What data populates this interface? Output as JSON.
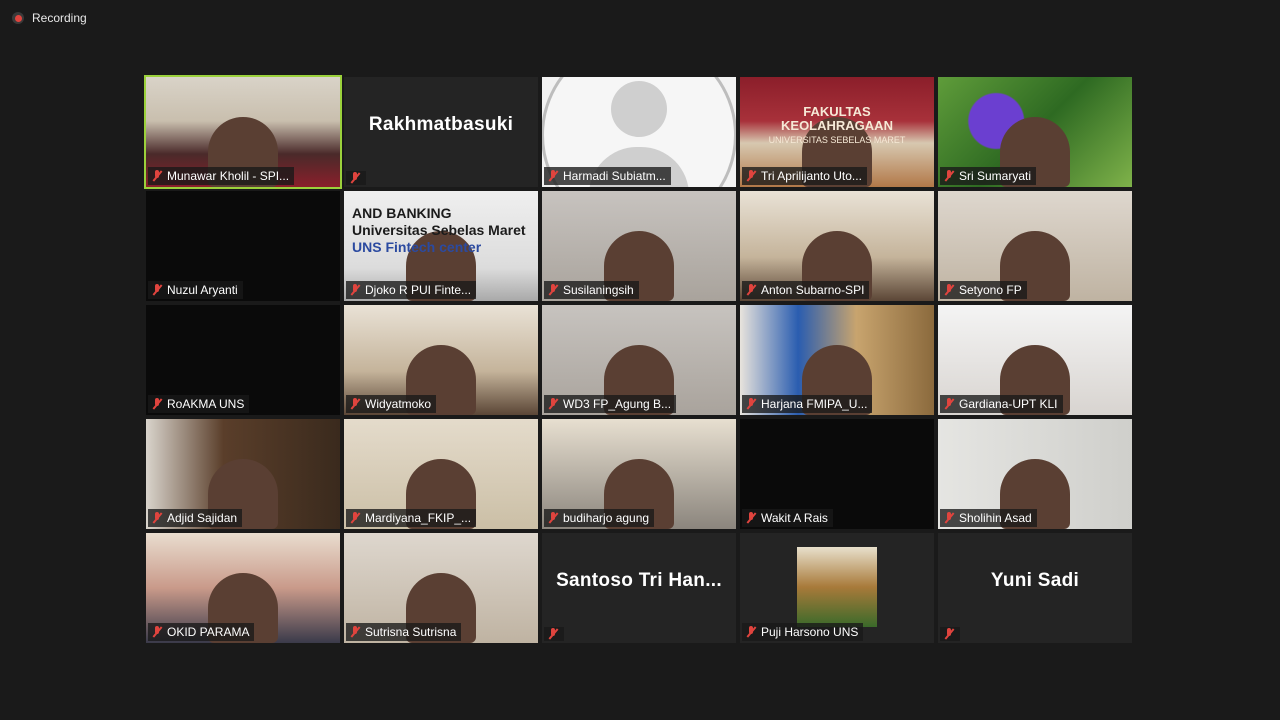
{
  "recording": {
    "label": "Recording"
  },
  "participants": [
    {
      "name": "Munawar Kholil - SPI...",
      "view": "video",
      "bg": "v-office1",
      "active": true
    },
    {
      "name": "",
      "view": "name",
      "display_name": "Rakhmatbasuki"
    },
    {
      "name": "Harmadi Subiatm...",
      "view": "avatar"
    },
    {
      "name": "Tri Aprilijanto Uto...",
      "view": "video",
      "bg": "v-poster",
      "overlay": "poster"
    },
    {
      "name": "Sri Sumaryati",
      "view": "video",
      "bg": "v-flower"
    },
    {
      "name": "Nuzul Aryanti",
      "view": "video",
      "bg": "v-dark"
    },
    {
      "name": "Djoko R PUI Finte...",
      "view": "video",
      "bg": "v-bank",
      "overlay": "bank"
    },
    {
      "name": "Susilaningsih",
      "view": "video",
      "bg": "v-gray"
    },
    {
      "name": "Anton Subarno-SPI",
      "view": "video",
      "bg": "v-room"
    },
    {
      "name": "Setyono FP",
      "view": "video",
      "bg": "v-room2"
    },
    {
      "name": "RoAKMA UNS",
      "view": "video",
      "bg": "v-dark"
    },
    {
      "name": "Widyatmoko",
      "view": "video",
      "bg": "v-room"
    },
    {
      "name": "WD3 FP_Agung B...",
      "view": "video",
      "bg": "v-gray"
    },
    {
      "name": "Harjana FMIPA_U...",
      "view": "video",
      "bg": "v-blue"
    },
    {
      "name": "Gardiana-UPT KLI",
      "view": "video",
      "bg": "v-white"
    },
    {
      "name": "Adjid Sajidan",
      "view": "video",
      "bg": "v-shelf"
    },
    {
      "name": "Mardiyana_FKIP_...",
      "view": "video",
      "bg": "v-wall"
    },
    {
      "name": "budiharjo agung",
      "view": "video",
      "bg": "v-wood"
    },
    {
      "name": "Wakit A Rais",
      "view": "video",
      "bg": "v-dark"
    },
    {
      "name": "Sholihin Asad",
      "view": "video",
      "bg": "v-light"
    },
    {
      "name": "OKID PARAMA",
      "view": "video",
      "bg": "v-red"
    },
    {
      "name": "Sutrisna Sutrisna",
      "view": "video",
      "bg": "v-room2"
    },
    {
      "name": "",
      "view": "name",
      "display_name": "Santoso Tri Han..."
    },
    {
      "name": "Puji Harsono UNS",
      "view": "thumb"
    },
    {
      "name": "",
      "view": "name",
      "display_name": "Yuni Sadi"
    }
  ],
  "overlays": {
    "poster": {
      "line1": "FAKULTAS",
      "line2": "KEOLAHRAGAAN",
      "line3": "UNIVERSITAS SEBELAS MARET"
    },
    "bank": {
      "line1": "AND BANKING",
      "line2": "Universitas Sebelas Maret",
      "line3": "UNS Fintech center"
    }
  },
  "colors": {
    "active_border": "#9bd13b",
    "mute_icon": "#e0443e",
    "background": "#1a1a1a"
  }
}
